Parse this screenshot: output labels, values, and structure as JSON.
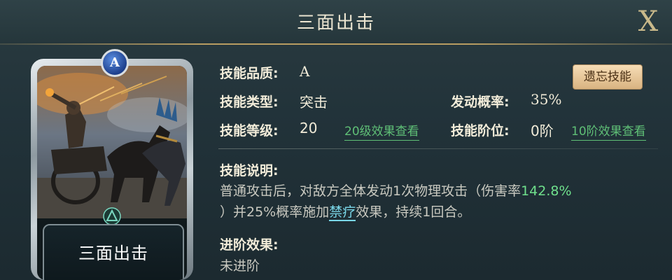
{
  "header": {
    "title": "三面出击",
    "close_label": "X"
  },
  "card": {
    "name": "三面出击",
    "quality_badge": "A",
    "quality_color": "#2f5fc0"
  },
  "info": {
    "quality_label": "技能品质:",
    "quality_value": "A",
    "type_label": "技能类型:",
    "type_value": "突击",
    "chance_label": "发动概率:",
    "chance_value": "35%",
    "level_label": "技能等级:",
    "level_value": "20",
    "level_link": "20级效果查看",
    "tier_label": "技能阶位:",
    "tier_value": "0阶",
    "tier_link": "10阶效果查看",
    "forget_button": "遗忘技能"
  },
  "description": {
    "label": "技能说明:",
    "part1": "普通攻击后，对敌方全体发动1次物理攻击（伤害率",
    "damage_rate": "142.8%",
    "part2": "）并25%概率施加",
    "status_link": "禁疗",
    "part3": "效果，持续1回合。"
  },
  "advance": {
    "label": "进阶效果:",
    "value": "未进阶"
  },
  "colors": {
    "accent_green": "#6fe08c",
    "link_green": "#5fbf76",
    "link_cyan": "#7ad7e8",
    "gold": "#b89d62"
  }
}
